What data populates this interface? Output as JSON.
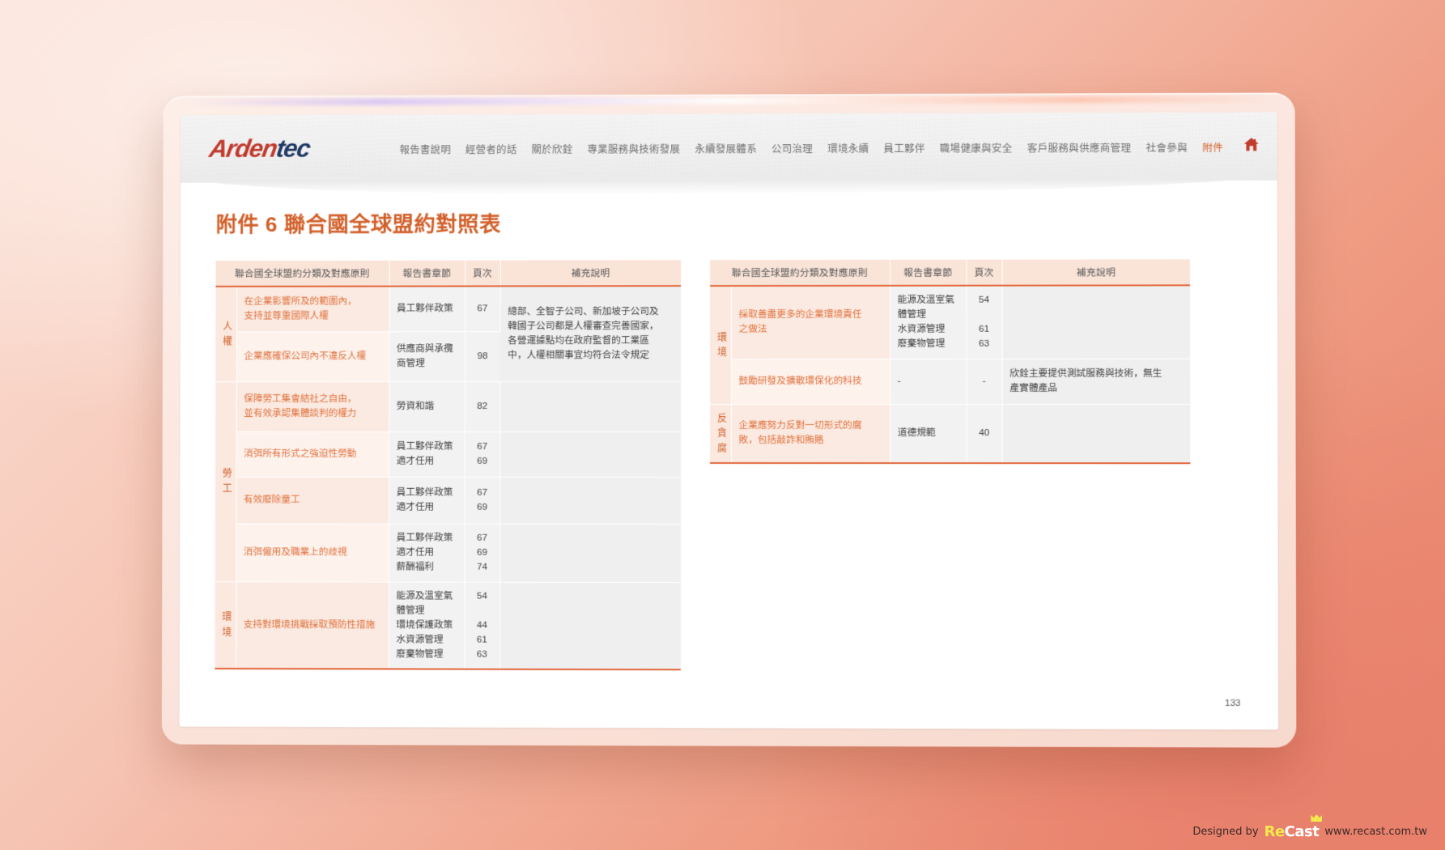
{
  "brand": {
    "logo_part1": "Arden",
    "logo_part2": "tec",
    "home_icon": "home-icon"
  },
  "nav": {
    "items": [
      {
        "label": "報告書說明",
        "active": false
      },
      {
        "label": "經營者的話",
        "active": false
      },
      {
        "label": "關於欣銓",
        "active": false
      },
      {
        "label": "專業服務與技術發展",
        "active": false
      },
      {
        "label": "永續發展體系",
        "active": false
      },
      {
        "label": "公司治理",
        "active": false
      },
      {
        "label": "環境永續",
        "active": false
      },
      {
        "label": "員工夥伴",
        "active": false
      },
      {
        "label": "職場健康與安全",
        "active": false
      },
      {
        "label": "客戶服務與供應商管理",
        "active": false
      },
      {
        "label": "社會參與",
        "active": false
      },
      {
        "label": "附件",
        "active": true
      }
    ]
  },
  "page": {
    "title": "附件 6 聯合國全球盟約對照表",
    "number": "133"
  },
  "table_headers": {
    "principle": "聯合國全球盟約分類及對應原則",
    "chapter": "報告書章節",
    "page": "頁次",
    "note": "補充說明"
  },
  "left_table": {
    "rows": [
      {
        "category": "人權",
        "category_rowspan": 2,
        "principle": "在企業影響所及的範圍內，\n支持並尊重國際人權",
        "chapter": "員工夥伴政策",
        "page": "67",
        "note": "總部、全智子公司、新加坡子公司及\n韓國子公司都是人權審查完善國家，\n各營運據點均在政府監督的工業區\n中，人權相關事宜均符合法令規定",
        "note_rowspan": 2
      },
      {
        "principle": "企業應確保公司內不違反人權",
        "chapter": "供應商與承攬\n商管理",
        "page": "98"
      },
      {
        "category": "勞工",
        "category_rowspan": 4,
        "principle": "保障勞工集會結社之自由，\n並有效承認集體談判的權力",
        "chapter": "勞資和諧",
        "page": "82",
        "note": ""
      },
      {
        "principle": "消弭所有形式之強迫性勞動",
        "chapter": "員工夥伴政策\n適才任用",
        "page": "67\n69",
        "note": ""
      },
      {
        "principle": "有效廢除童工",
        "chapter": "員工夥伴政策\n適才任用",
        "page": "67\n69",
        "note": ""
      },
      {
        "principle": "消弭僱用及職業上的歧視",
        "chapter": "員工夥伴政策\n適才任用\n薪酬福利",
        "page": "67\n69\n74",
        "note": ""
      },
      {
        "category": "環境",
        "category_rowspan": 1,
        "principle": "支持對環境挑戰採取預防性措施",
        "chapter": "能源及溫室氣\n體管理\n環境保護政策\n水資源管理\n廢棄物管理",
        "page": "54\n\n44\n61\n63",
        "note": ""
      }
    ]
  },
  "right_table": {
    "rows": [
      {
        "category": "環境",
        "category_rowspan": 2,
        "principle": "採取善盡更多的企業環境責任\n之做法",
        "chapter": "能源及溫室氣\n體管理\n水資源管理\n廢棄物管理",
        "page": "54\n\n61\n63",
        "note": ""
      },
      {
        "principle": "鼓勵研發及擴散環保化的科技",
        "chapter": "-",
        "page": "-",
        "note": "欣銓主要提供測試服務與技術，無生\n產實體產品"
      },
      {
        "category": "反貪腐",
        "category_rowspan": 1,
        "principle": "企業應努力反對一切形式的腐\n敗，包括敲詐和賄賂",
        "chapter": "道德規範",
        "page": "40",
        "note": ""
      }
    ]
  },
  "footer": {
    "designed_by": "Designed by",
    "logo_re": "Re",
    "logo_cast": "Cast",
    "url": "www.recast.com.tw"
  },
  "colors": {
    "accent": "#d2602a",
    "header_bg": "#fae4d8",
    "rule": "#e2663a",
    "logo_red": "#c0392b",
    "logo_navy": "#1f3864"
  }
}
